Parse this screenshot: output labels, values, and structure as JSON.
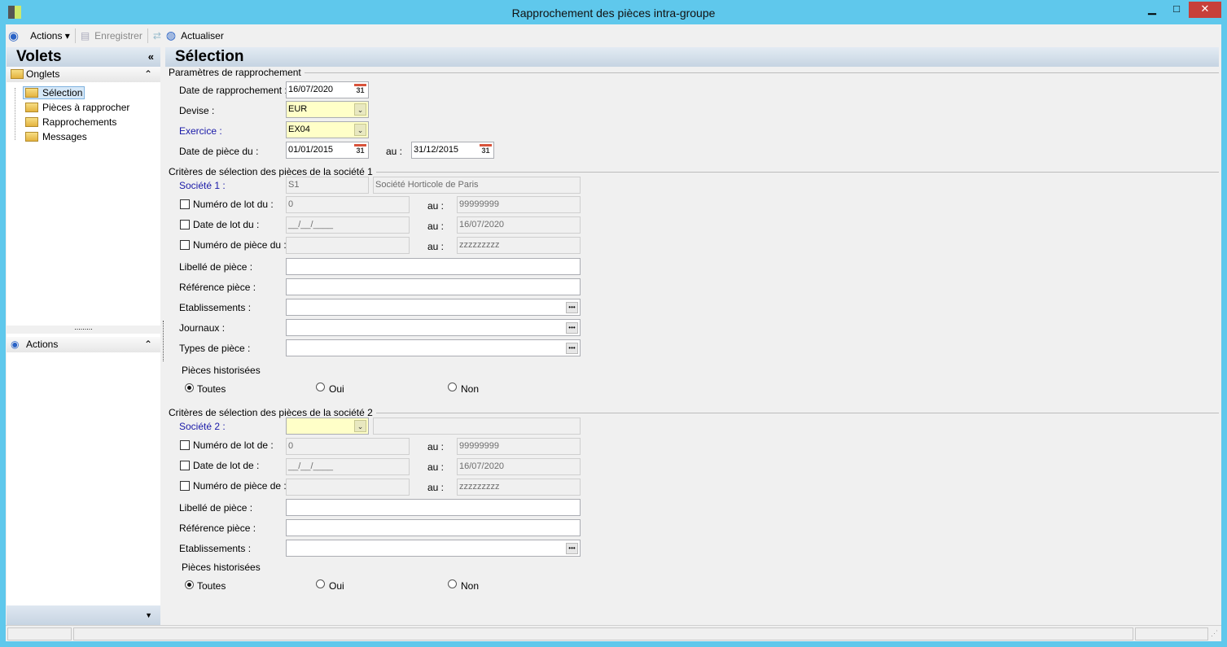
{
  "window": {
    "title": "Rapprochement des pièces intra-groupe",
    "minimize": "▁",
    "maximize": "□",
    "close": "✕"
  },
  "toolbar": {
    "actions": "Actions",
    "save": "Enregistrer",
    "refresh": "Actualiser"
  },
  "left": {
    "title": "Volets",
    "collapse": "«",
    "tabs_header": "Onglets",
    "tabs": [
      "Sélection",
      "Pièces à rapprocher",
      "Rapprochements",
      "Messages"
    ],
    "actions_header": "Actions",
    "splitter": "........."
  },
  "main": {
    "title": "Sélection",
    "params": {
      "title": "Paramètres de rapprochement",
      "date_label": "Date de rapprochement :",
      "date": "16/07/2020",
      "devise_label": "Devise :",
      "devise": "EUR",
      "exercice_label": "Exercice :",
      "exercice": "EX04",
      "piece_label": "Date de pièce du :",
      "piece_from": "01/01/2015",
      "au": "au :",
      "piece_to": "31/12/2015",
      "cal": "31"
    },
    "s1": {
      "title": "Critères de sélection des pièces de la société 1",
      "soc_label": "Société 1 :",
      "soc_code": "S1",
      "soc_name": "Société Horticole de Paris",
      "lot_label": "Numéro de lot du :",
      "lot_from": "0",
      "lot_to": "99999999",
      "datelot_label": "Date de lot du :",
      "datelot_from": "__/__/____",
      "datelot_to": "16/07/2020",
      "num_label": "Numéro de pièce du :",
      "num_from": "",
      "num_to": "zzzzzzzzz",
      "au": "au :",
      "libelle_label": "Libellé de pièce :",
      "ref_label": "Référence pièce :",
      "etab_label": "Etablissements :",
      "journaux_label": "Journaux :",
      "types_label": "Types de pièce :",
      "hist_label": "Pièces historisées",
      "opt": [
        "Toutes",
        "Oui",
        "Non"
      ],
      "selected": "Toutes"
    },
    "s2": {
      "title": "Critères de sélection des pièces de la société 2",
      "soc_label": "Société 2 :",
      "soc_code": "",
      "soc_name": "",
      "lot_label": "Numéro de lot de :",
      "lot_from": "0",
      "lot_to": "99999999",
      "datelot_label": "Date de lot de :",
      "datelot_from": "__/__/____",
      "datelot_to": "16/07/2020",
      "num_label": "Numéro de pièce de :",
      "num_from": "",
      "num_to": "zzzzzzzzz",
      "au": "au :",
      "libelle_label": "Libellé de pièce :",
      "ref_label": "Référence pièce :",
      "etab_label": "Etablissements :",
      "hist_label": "Pièces historisées",
      "opt": [
        "Toutes",
        "Oui",
        "Non"
      ],
      "selected": "Toutes"
    }
  }
}
